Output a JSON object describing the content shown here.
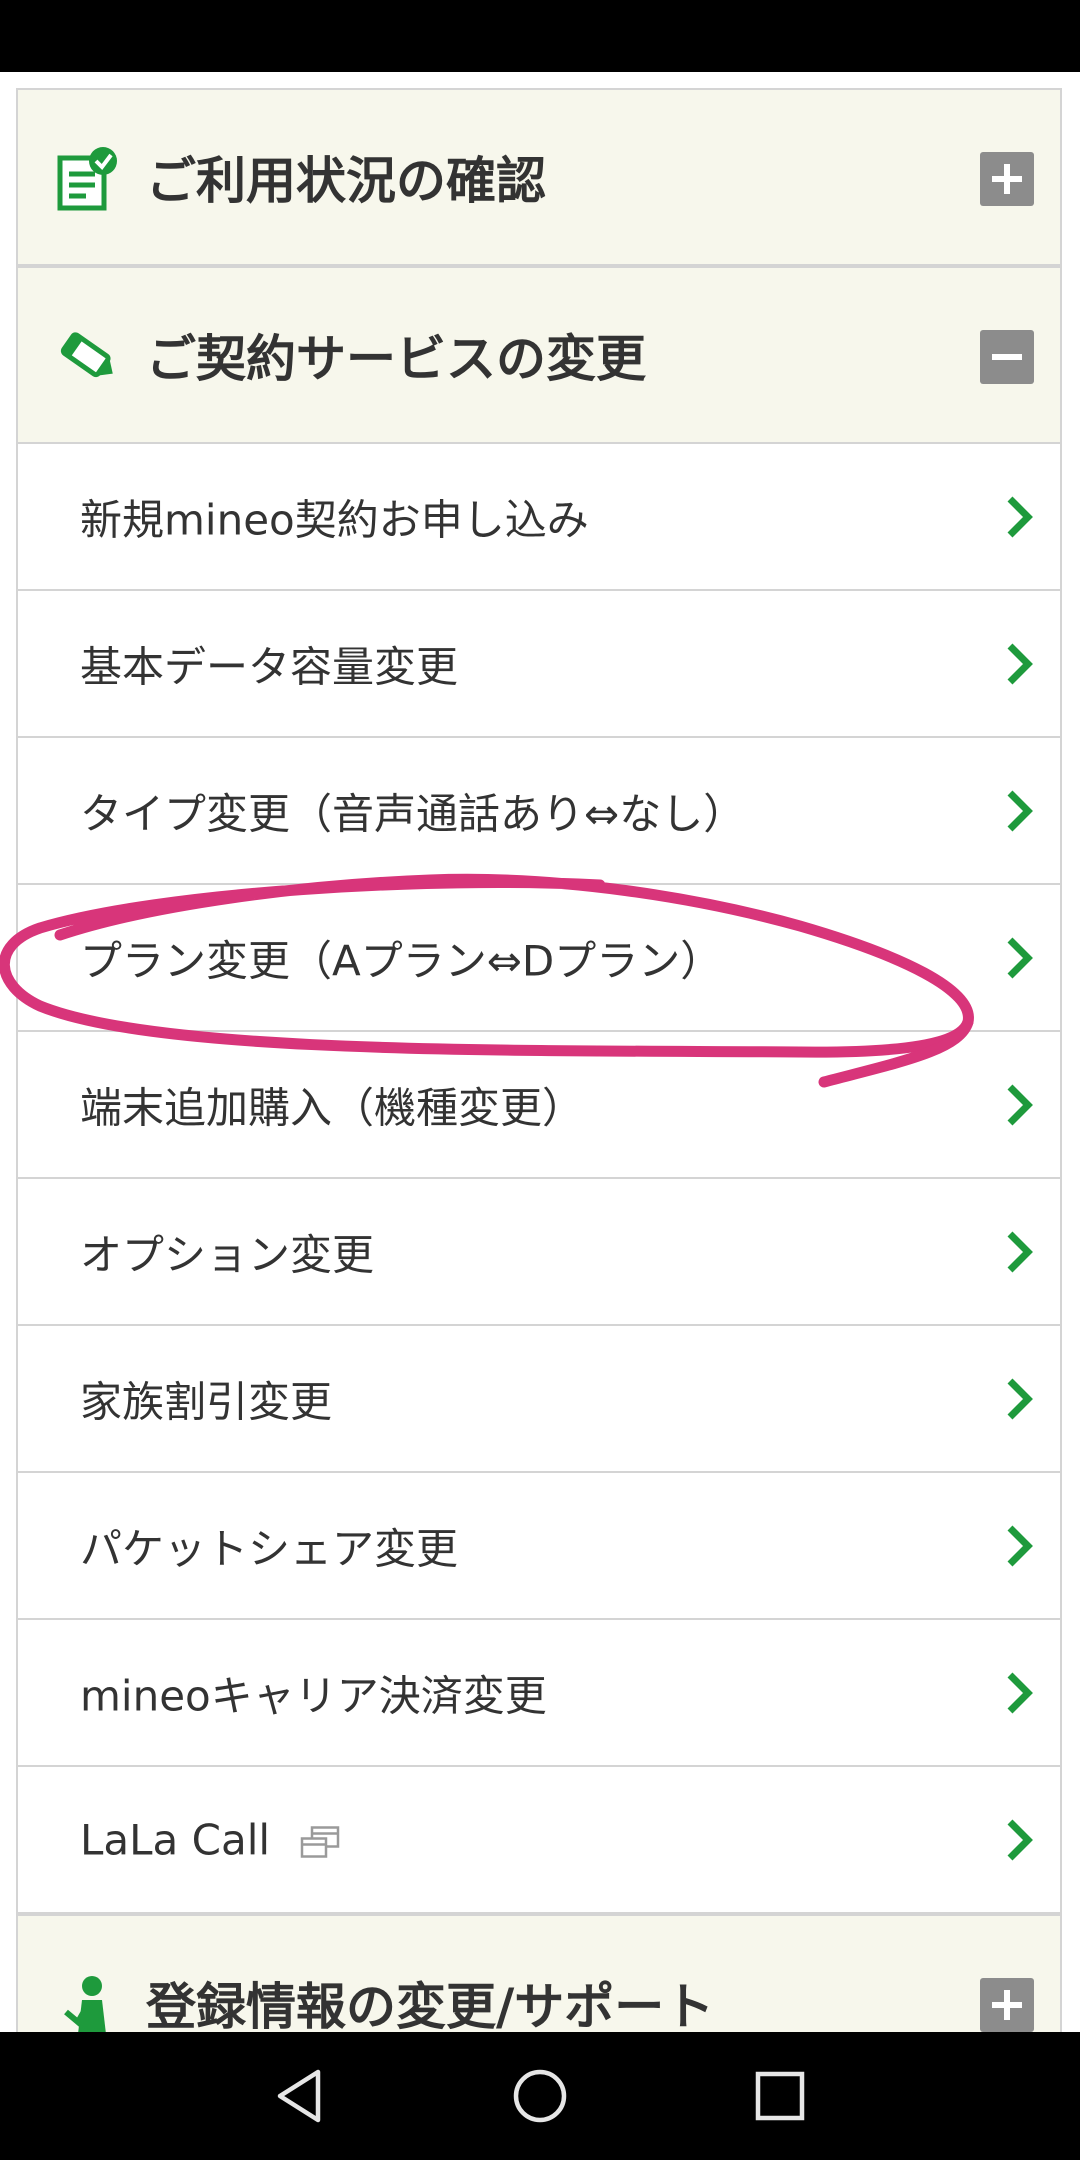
{
  "sections": {
    "usage": {
      "title": "ご利用状況の確認",
      "icon": "checklist-icon",
      "state": "collapsed"
    },
    "contract": {
      "title": "ご契約サービスの変更",
      "icon": "pencil-icon",
      "state": "expanded",
      "items": [
        {
          "label": "新規mineo契約お申し込み"
        },
        {
          "label": "基本データ容量変更"
        },
        {
          "label": "タイプ変更（音声通話あり⇔なし）"
        },
        {
          "label": "プラン変更（Aプラン⇔Dプラン）"
        },
        {
          "label": "端末追加購入（機種変更）"
        },
        {
          "label": "オプション変更"
        },
        {
          "label": "家族割引変更"
        },
        {
          "label": "パケットシェア変更"
        },
        {
          "label": "mineoキャリア決済変更"
        },
        {
          "label": "LaLa Call",
          "external": true
        }
      ]
    },
    "registration": {
      "title": "登録情報の変更/サポート",
      "icon": "person-icon",
      "state": "collapsed"
    }
  },
  "colors": {
    "accent_green": "#1e9a3c",
    "header_bg": "#f7f7ec",
    "toggle_gray": "#8c8c8c",
    "annotation_pink": "#d8357a"
  }
}
